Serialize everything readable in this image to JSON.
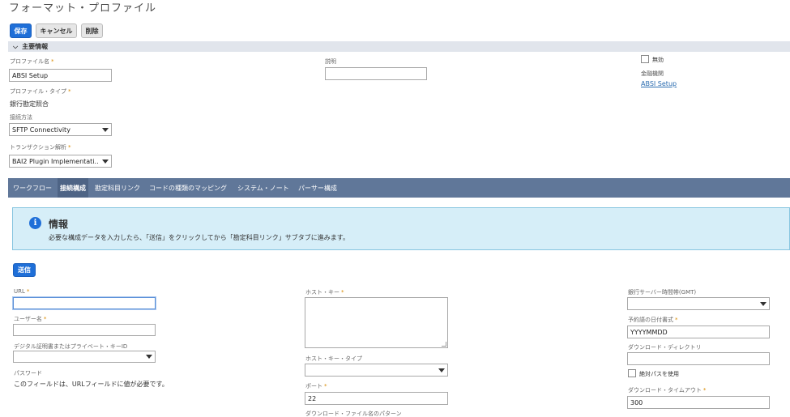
{
  "page": {
    "title": "フォーマット・プロファイル"
  },
  "toolbar": {
    "save": "保存",
    "cancel": "キャンセル",
    "delete": "削除"
  },
  "primary_section": {
    "title": "主要情報"
  },
  "fields": {
    "profile_name": {
      "label": "プロファイル名",
      "value": "ABSI Setup"
    },
    "profile_type": {
      "label": "プロファイル・タイプ",
      "value": "銀行勘定照合"
    },
    "connection_method": {
      "label": "接続方法",
      "value": "SFTP Connectivity"
    },
    "transaction_parser": {
      "label": "トランザクション解析",
      "value": "BAI2 Plugin Implementati..."
    },
    "description": {
      "label": "説明",
      "value": ""
    },
    "inactive": {
      "label": "無効",
      "checked": false
    },
    "financial_institution": {
      "label": "金融機関",
      "value": "ABSI Setup"
    }
  },
  "tabs": [
    {
      "label": "ワークフロー",
      "active": false
    },
    {
      "label": "接続構成",
      "active": true
    },
    {
      "label": "勘定科目リンク",
      "active": false
    },
    {
      "label": "コードの種類のマッピング",
      "active": false
    },
    {
      "label": "システム・ノート",
      "active": false
    },
    {
      "label": "パーサー構成",
      "active": false
    }
  ],
  "info": {
    "icon": "info-icon",
    "title": "情報",
    "text": "必要な構成データを入力したら、「送信」をクリックしてから「勘定科目リンク」サブタブに進みます。"
  },
  "connection": {
    "submit": "送信",
    "url": {
      "label": "URL",
      "value": ""
    },
    "username": {
      "label": "ユーザー名",
      "value": ""
    },
    "cert_key_id": {
      "label": "デジタル証明書またはプライベート・キーID",
      "value": ""
    },
    "password": {
      "label": "パスワード",
      "note": "このフィールドは、URLフィールドに値が必要です。"
    },
    "host_key": {
      "label": "ホスト・キー",
      "value": ""
    },
    "host_key_type": {
      "label": "ホスト・キー・タイプ",
      "value": ""
    },
    "port": {
      "label": "ポート",
      "value": "22"
    },
    "download_file_pattern": {
      "label": "ダウンロード・ファイル名のパターン"
    },
    "bank_timezone": {
      "label": "銀行サーバー時間帯(GMT)",
      "value": ""
    },
    "date_format": {
      "label": "予約語の日付書式",
      "value": "YYYYMMDD"
    },
    "download_dir": {
      "label": "ダウンロード・ディレクトリ",
      "value": ""
    },
    "use_absolute_path": {
      "label": "絶対パスを使用",
      "checked": false
    },
    "download_timeout": {
      "label": "ダウンロード・タイムアウト",
      "value": "300"
    }
  },
  "colors": {
    "primary": "#1f6fd8",
    "tabbar": "#607799",
    "info_bg": "#d6eef8",
    "required": "#d98b00"
  }
}
